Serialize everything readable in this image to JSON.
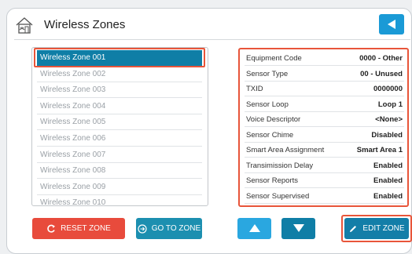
{
  "header": {
    "title": "Wireless Zones",
    "back_icon": "left-triangle-icon"
  },
  "zones": [
    "Wireless Zone 001",
    "Wireless Zone 002",
    "Wireless Zone 003",
    "Wireless Zone 004",
    "Wireless Zone 005",
    "Wireless Zone 006",
    "Wireless Zone 007",
    "Wireless Zone 008",
    "Wireless Zone 009",
    "Wireless Zone 010"
  ],
  "selected_zone": 0,
  "details": [
    {
      "label": "Equipment Code",
      "value": "0000 - Other"
    },
    {
      "label": "Sensor Type",
      "value": "00 - Unused"
    },
    {
      "label": "TXID",
      "value": "0000000"
    },
    {
      "label": "Sensor Loop",
      "value": "Loop 1"
    },
    {
      "label": "Voice Descriptor",
      "value": "<None>"
    },
    {
      "label": "Sensor Chime",
      "value": "Disabled"
    },
    {
      "label": "Smart Area Assignment",
      "value": "Smart Area 1"
    },
    {
      "label": "Transimission Delay",
      "value": "Enabled"
    },
    {
      "label": "Sensor Reports",
      "value": "Enabled"
    },
    {
      "label": "Sensor Supervised",
      "value": "Enabled"
    }
  ],
  "buttons": {
    "reset": "RESET ZONE",
    "goto": "GO TO ZONE",
    "edit": "EDIT ZONE"
  },
  "colors": {
    "accent": "#0f7ea6",
    "danger": "#e84b3c",
    "highlight": "#e8553a"
  }
}
